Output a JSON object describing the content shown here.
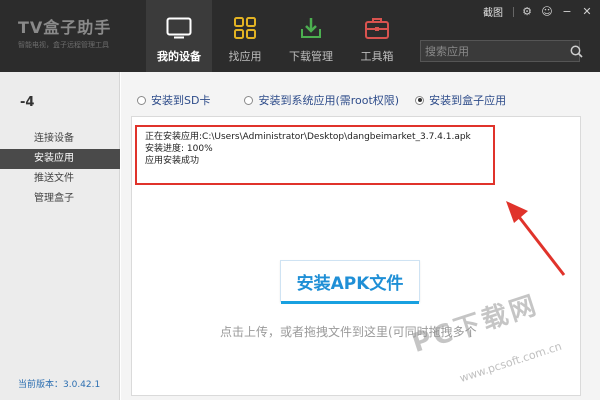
{
  "app": {
    "logo_title": "TV盒子助手",
    "logo_subtitle": "智能电视，盒子远程管理工具"
  },
  "nav": {
    "items": [
      {
        "label": "我的设备",
        "icon": "tv-icon",
        "active": true
      },
      {
        "label": "找应用",
        "icon": "grid-apps-icon",
        "active": false
      },
      {
        "label": "下载管理",
        "icon": "download-icon",
        "active": false
      },
      {
        "label": "工具箱",
        "icon": "toolbox-icon",
        "active": false
      }
    ]
  },
  "window_controls": {
    "screenshot_label": "截图"
  },
  "search": {
    "placeholder": "搜索应用"
  },
  "sidebar": {
    "device_id": "-4",
    "items": [
      {
        "label": "连接设备",
        "active": false
      },
      {
        "label": "安装应用",
        "active": true
      },
      {
        "label": "推送文件",
        "active": false
      },
      {
        "label": "管理盒子",
        "active": false
      }
    ],
    "version": "当前版本：3.0.42.1"
  },
  "install_target": {
    "options": [
      {
        "label": "安装到SD卡",
        "selected": false
      },
      {
        "label": "安装到系统应用(需root权限)",
        "selected": false
      },
      {
        "label": "安装到盒子应用",
        "selected": true
      }
    ]
  },
  "log": {
    "line1": "正在安装应用:C:\\Users\\Administrator\\Desktop\\dangbeimarket_3.7.4.1.apk",
    "line2": "安装进度:  100%",
    "line3": "应用安装成功"
  },
  "main": {
    "install_button": "安装APK文件",
    "hint": "点击上传，或者拖拽文件到这里(可同时拖拽多个"
  },
  "watermark": {
    "main": "PC下载网",
    "url": "www.pcsoft.com.cn"
  },
  "colors": {
    "header_bg": "#2c2c2c",
    "accent_blue": "#1f8fd6",
    "highlight_red": "#e0332b",
    "nav_icon_yellow": "#e3b323",
    "nav_icon_green": "#4caf50",
    "nav_icon_red": "#d9534f"
  }
}
